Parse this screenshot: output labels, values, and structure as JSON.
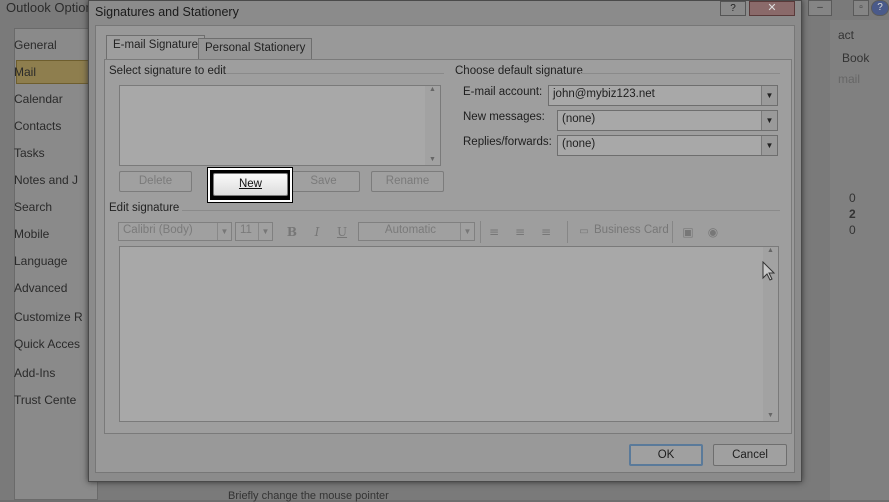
{
  "background_window": {
    "title": "Outlook Options",
    "sidebar": [
      "General",
      "Mail",
      "Calendar",
      "Contacts",
      "Tasks",
      "Notes and J",
      "Search",
      "Mobile",
      "Language",
      "Advanced",
      "Customize R",
      "Quick Acces",
      "Add-Ins",
      "Trust Cente"
    ],
    "selected": "Mail",
    "right_fragments": [
      "act",
      "Book",
      "mail",
      "0",
      "2",
      "0"
    ],
    "bottom_text": "Briefly change the mouse pointer"
  },
  "dialog": {
    "title": "Signatures and Stationery",
    "help_label": "?",
    "close_label": "✕",
    "tabs": [
      "E-mail Signature",
      "Personal Stationery"
    ],
    "select_signature_label": "Select signature to edit",
    "choose_default_label": "Choose default signature",
    "buttons": {
      "delete": "Delete",
      "new": "New",
      "save": "Save",
      "rename": "Rename"
    },
    "fields": {
      "email_account_label": "E-mail account:",
      "email_account_value": "john@mybiz123.net",
      "new_messages_label": "New messages:",
      "new_messages_value": "(none)",
      "replies_label": "Replies/forwards:",
      "replies_value": "(none)"
    },
    "edit_signature_label": "Edit signature",
    "toolbar": {
      "font": "Calibri (Body)",
      "size": "11",
      "bold": "B",
      "italic": "I",
      "underline": "U",
      "color": "Automatic",
      "business_card": "Business Card"
    },
    "ok_label": "OK",
    "cancel_label": "Cancel"
  }
}
